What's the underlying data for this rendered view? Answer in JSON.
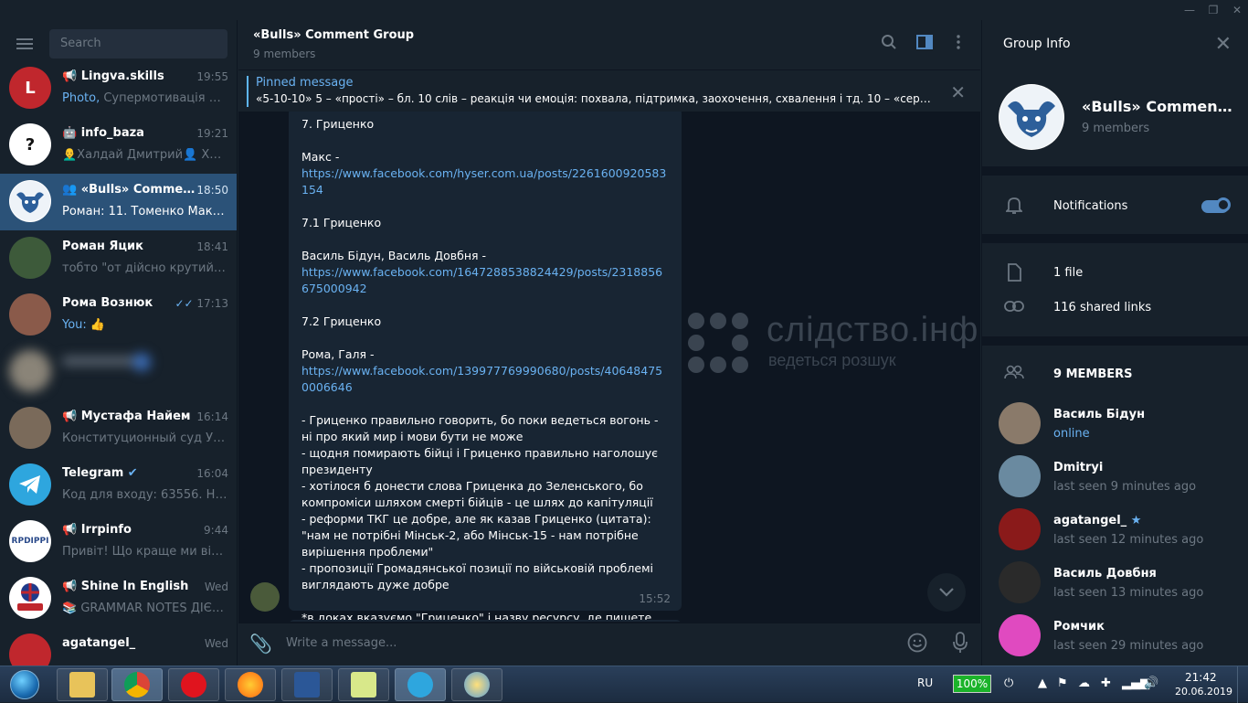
{
  "window": {
    "min": "—",
    "restore": "❐",
    "close": "✕"
  },
  "sidebar": {
    "search_placeholder": "Search",
    "chats": [
      {
        "name": "Lingva.skills",
        "time": "19:55",
        "preview_hl": "Photo, ",
        "preview": "Супермотивація на в...",
        "avatar_text": "L",
        "avatar_color": "#c0272d"
      },
      {
        "name": "info_baza",
        "time": "19:21",
        "preview_hl": "",
        "preview": "👨‍🦲Халдай Дмитрий👤 Хал...",
        "avatar_text": "?",
        "avatar_color": "#ffffff"
      },
      {
        "name": "«Bulls» Comment ...",
        "time": "18:50",
        "preview_hl": "Роман: ",
        "preview": "11. Томенко  Макс, ...",
        "avatar_text": "",
        "avatar_color": "#ffffff"
      },
      {
        "name": "Роман Яцик",
        "time": "18:41",
        "preview_hl": "",
        "preview": "тобто \"от дійсно крутий ре...",
        "avatar_text": "",
        "avatar_color": "#3d5a3a"
      },
      {
        "name": "Рома Вознюк",
        "time": "17:13",
        "preview_hl": "You: ",
        "preview": "👍",
        "avatar_text": "",
        "avatar_color": "#8a5a4a"
      },
      {
        "name": "Мустафа Найем",
        "time": "16:14",
        "preview_hl": "",
        "preview": "Конституционный суд Укра...",
        "avatar_text": "",
        "avatar_color": "#7a6a5a"
      },
      {
        "name": "Telegram",
        "time": "16:04",
        "preview_hl": "",
        "preview": "Код для входу: 63556. Не по...",
        "avatar_text": "",
        "avatar_color": "#2ea6de"
      },
      {
        "name": "Irrpinfo",
        "time": "9:44",
        "preview_hl": "",
        "preview": "Привіт!  Що краще ми візуа...",
        "avatar_text": "RPDIPPI",
        "avatar_color": "#ffffff"
      },
      {
        "name": "Shine In English",
        "time": "Wed",
        "preview_hl": "",
        "preview": "📚 GRAMMAR NOTES ДІЄСЛ...",
        "avatar_text": "",
        "avatar_color": "#ffffff"
      },
      {
        "name": "agatangel_",
        "time": "Wed",
        "preview_hl": "",
        "preview": "",
        "avatar_text": "",
        "avatar_color": "#c0272d"
      }
    ]
  },
  "chat": {
    "title": "«Bulls» Comment Group",
    "subtitle": "9 members",
    "pinned_title": "Pinned message",
    "pinned_text": "«5-10-10»  5 – «прості» – бл. 10 слів – реакція чи емоція: похвала, підтримка, заохочення, схвалення і тд. 10 – «середні» ...",
    "message": {
      "l1": "7. Гриценко",
      "l2": "Макс -",
      "link1": "https://www.facebook.com/hyser.com.ua/posts/2261600920583154",
      "l3": "7.1 Гриценко",
      "l4": "Василь Бідун, Василь Довбня -",
      "link2": "https://www.facebook.com/1647288538824429/posts/2318856675000942",
      "l5": "7.2 Гриценко",
      "l6": "Рома, Галя -",
      "link3": "https://www.facebook.com/139977769990680/posts/406484750006646",
      "body": "- Гриценко правильно говорить, бо поки ведеться вогонь - ні про який мир і мови бути не може\n- щодня помирають бійці і Гриценко правильно наголошує президенту\n- хотілося б донести слова Гриценка до Зеленського, бо компроміси шляхом смерті бійців - це шлях до капітуляції\n- реформи ТКГ це добре, але як казав Гриценко (цитата): \"нам не потрібні Мінськ-2, або Мінськ-15 - нам потрібне вирішення проблеми\"\n- пропозиції Громадянської позиції по військовій проблемі виглядають дуже добре",
      "last": "*в доках вказуємо \"Гриценко\" і назву ресурсу, де пишете",
      "time": "15:52"
    },
    "watermark_title": "слідство.інфо",
    "watermark_sub": "ведеться розшук",
    "composer_placeholder": "Write a message..."
  },
  "info": {
    "title": "Group Info",
    "group_name": "«Bulls» Comment G...",
    "group_count": "9 members",
    "notifications": "Notifications",
    "notifications_on": true,
    "files": "1 file",
    "links": "116 shared links",
    "members_header": "9 MEMBERS",
    "members": [
      {
        "name": "Василь Бідун",
        "status": "online",
        "color": "#8a7a6a"
      },
      {
        "name": "Dmitryi",
        "status": "last seen 9 minutes ago",
        "color": "#6a8aa0"
      },
      {
        "name": "agatangel_",
        "status": "last seen 12 minutes ago",
        "color": "#8a1a1a"
      },
      {
        "name": "Василь Довбня",
        "status": "last seen 13 minutes ago",
        "color": "#2a2a2a"
      },
      {
        "name": "Ромчик",
        "status": "last seen 29 minutes ago",
        "color": "#e04ac0"
      }
    ]
  },
  "taskbar": {
    "lang": "RU",
    "battery": "100%",
    "time": "21:42",
    "date": "20.06.2019"
  },
  "colors": {
    "accent": "#5288c1",
    "link": "#6ab2f2",
    "active_chat": "#2b5278",
    "bg": "#0e1621",
    "panel": "#17212b"
  }
}
